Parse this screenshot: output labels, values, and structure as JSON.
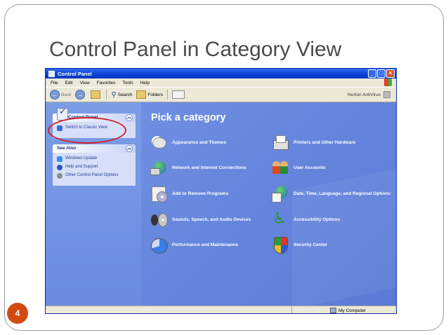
{
  "slide": {
    "title": "Control Panel in Category View",
    "page_number": "4"
  },
  "window": {
    "title": "Control Panel",
    "buttons": {
      "minimize": "_",
      "maximize": "□",
      "close": "✕"
    }
  },
  "menubar": {
    "items": [
      "File",
      "Edit",
      "View",
      "Favorites",
      "Tools",
      "Help"
    ]
  },
  "toolbar": {
    "back_label": "Back",
    "search_label": "Search",
    "folders_label": "Folders",
    "norton_label": "Norton AntiVirus"
  },
  "left_pane": {
    "control_panel": {
      "title": "Control Panel",
      "link": "Switch to Classic View"
    },
    "see_also": {
      "title": "See Also",
      "links": [
        "Windows Update",
        "Help and Support",
        "Other Control Panel Options"
      ]
    }
  },
  "main": {
    "heading": "Pick a category",
    "categories": [
      {
        "label": "Appearance and Themes",
        "icon": "themes-icon"
      },
      {
        "label": "Printers and Other Hardware",
        "icon": "printer-icon"
      },
      {
        "label": "Network and Internet Connections",
        "icon": "network-icon"
      },
      {
        "label": "User Accounts",
        "icon": "users-icon"
      },
      {
        "label": "Add or Remove Programs",
        "icon": "cd-box-icon"
      },
      {
        "label": "Date, Time, Language, and Regional Options",
        "icon": "globe-clock-icon"
      },
      {
        "label": "Sounds, Speech, and Audio Devices",
        "icon": "speaker-icon"
      },
      {
        "label": "Accessibility Options",
        "icon": "accessibility-icon"
      },
      {
        "label": "Performance and Maintenance",
        "icon": "pie-chart-icon"
      },
      {
        "label": "Security Center",
        "icon": "shield-icon"
      }
    ]
  },
  "statusbar": {
    "location": "My Computer"
  },
  "colors": {
    "titlebar": "#0a3fd0",
    "pane_blue": "#5f7fd9",
    "highlight_ellipse": "#d0222a",
    "page_badge": "#d14a12"
  }
}
